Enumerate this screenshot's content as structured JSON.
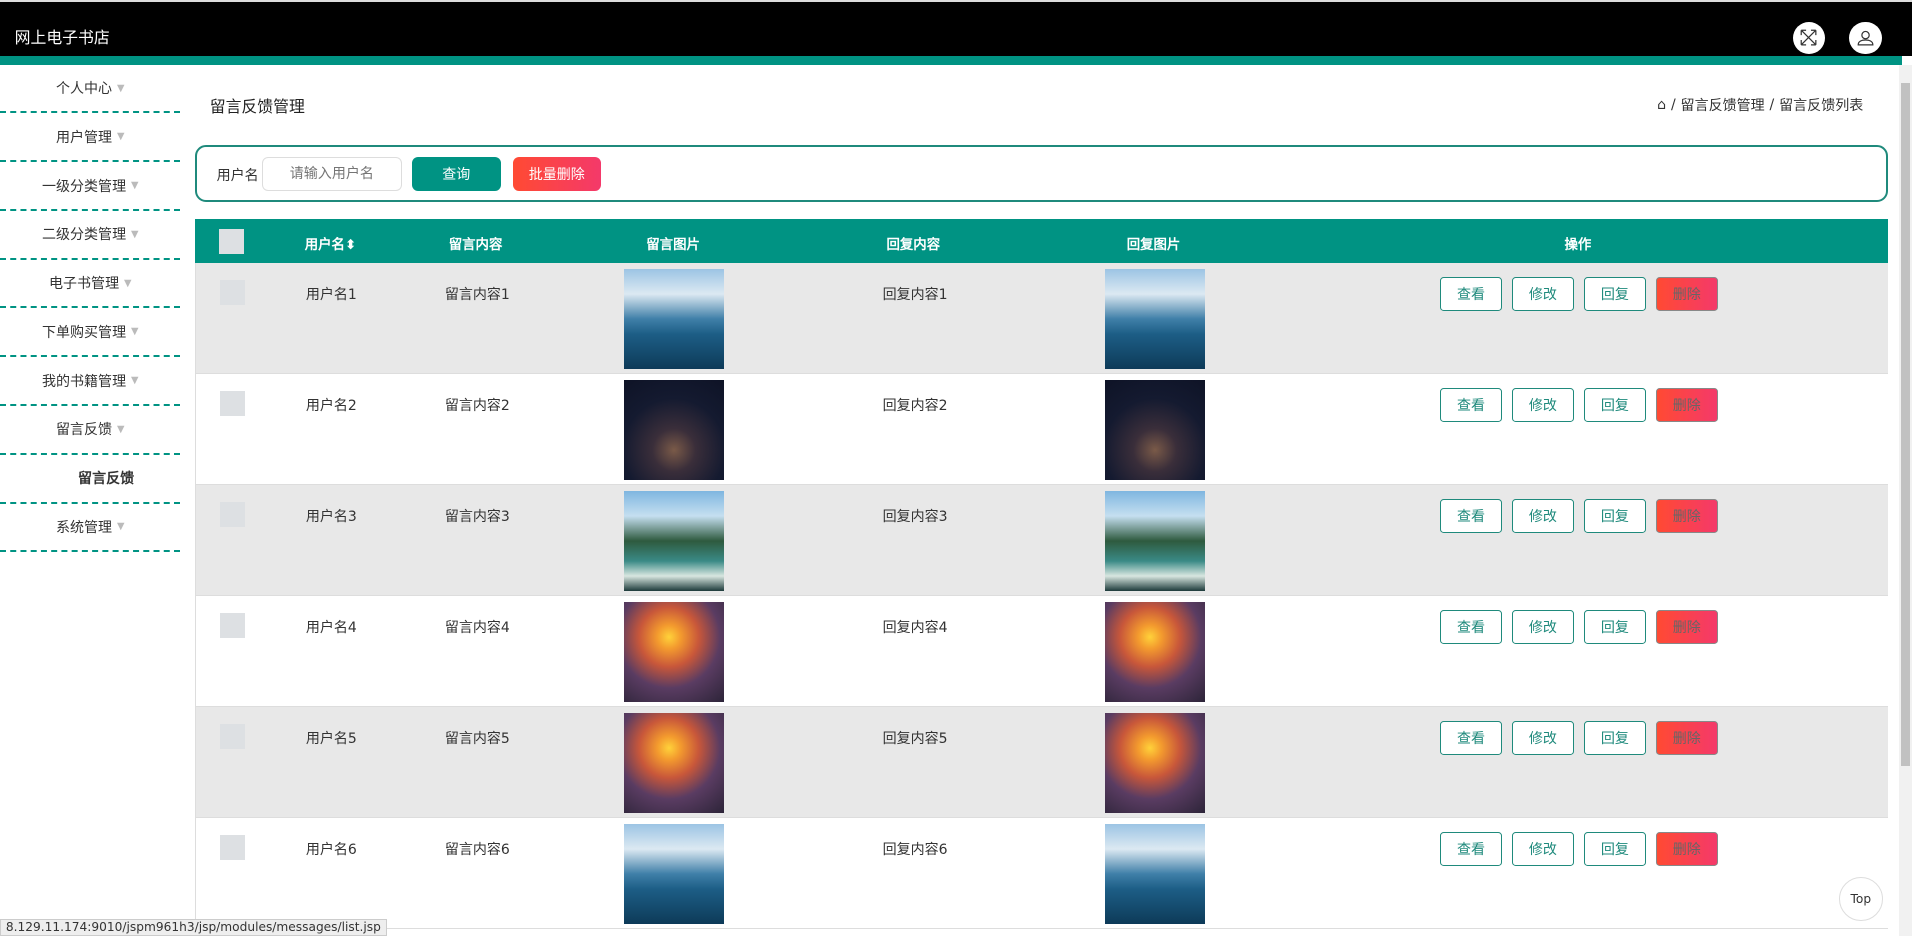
{
  "header": {
    "title": "网上电子书店",
    "icons": [
      "fullscreen-icon",
      "user-icon"
    ]
  },
  "sidebar": {
    "items": [
      {
        "label": "个人中心"
      },
      {
        "label": "用户管理"
      },
      {
        "label": "一级分类管理"
      },
      {
        "label": "二级分类管理"
      },
      {
        "label": "电子书管理"
      },
      {
        "label": "下单购买管理"
      },
      {
        "label": "我的书籍管理"
      },
      {
        "label": "留言反馈",
        "sub": "留言反馈"
      },
      {
        "label": "系统管理"
      }
    ]
  },
  "page": {
    "title": "留言反馈管理",
    "breadcrumb": [
      "留言反馈管理",
      "留言反馈列表"
    ]
  },
  "search": {
    "label": "用户名",
    "placeholder": "请输入用户名",
    "query": "查询",
    "batch_delete": "批量删除"
  },
  "table": {
    "headers": [
      "用户名",
      "留言内容",
      "留言图片",
      "回复内容",
      "回复图片",
      "操作"
    ],
    "actions": [
      "查看",
      "修改",
      "回复",
      "删除"
    ],
    "rows": [
      {
        "username": "用户名1",
        "content": "留言内容1",
        "reply": "回复内容1",
        "image": "lake"
      },
      {
        "username": "用户名2",
        "content": "留言内容2",
        "reply": "回复内容2",
        "image": "night-jar"
      },
      {
        "username": "用户名3",
        "content": "留言内容3",
        "reply": "回复内容3",
        "image": "mountain-lake"
      },
      {
        "username": "用户名4",
        "content": "留言内容4",
        "reply": "回复内容4",
        "image": "sunset-boat"
      },
      {
        "username": "用户名5",
        "content": "留言内容5",
        "reply": "回复内容5",
        "image": "sunset-boat"
      },
      {
        "username": "用户名6",
        "content": "留言内容6",
        "reply": "回复内容6",
        "image": "lake"
      }
    ]
  },
  "colors": {
    "accent": "#009383",
    "danger": "#ff4a33"
  },
  "top_button": "Top",
  "status_url": "8.129.11.174:9010/jspm961h3/jsp/modules/messages/list.jsp"
}
